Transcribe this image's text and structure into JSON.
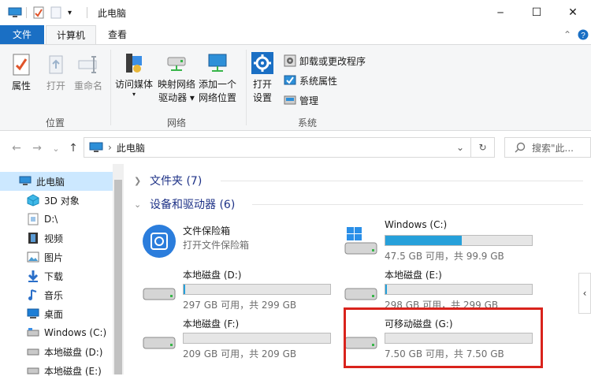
{
  "window": {
    "title": "此电脑",
    "qa_dropdown": "▾",
    "minimize": "─",
    "maximize": "☐",
    "close": "✕"
  },
  "tabs": {
    "file": "文件",
    "computer": "计算机",
    "view": "查看",
    "collapse": "⌃",
    "help": "?"
  },
  "ribbon": {
    "location": {
      "label": "位置",
      "properties": "属性",
      "open": "打开",
      "rename": "重命名"
    },
    "network": {
      "label": "网络",
      "media": "访问媒体",
      "map_drive_1": "映射网络",
      "map_drive_2": "驱动器 ▾",
      "add_location_1": "添加一个",
      "add_location_2": "网络位置"
    },
    "system": {
      "label": "系统",
      "open_settings_1": "打开",
      "open_settings_2": "设置",
      "uninstall": "卸载或更改程序",
      "sys_props": "系统属性",
      "manage": "管理"
    }
  },
  "address": {
    "back": "←",
    "forward": "→",
    "recent": "⌄",
    "up": "↑",
    "path": "此电脑",
    "sep": "›",
    "dropdown": "⌄",
    "refresh": "↻",
    "search_placeholder": "搜索\"此..."
  },
  "sidebar": {
    "items": [
      {
        "label": "此电脑"
      },
      {
        "label": "3D 对象"
      },
      {
        "label": "D:\\"
      },
      {
        "label": "视频"
      },
      {
        "label": "图片"
      },
      {
        "label": "下载"
      },
      {
        "label": "音乐"
      },
      {
        "label": "桌面"
      },
      {
        "label": "Windows (C:)"
      },
      {
        "label": "本地磁盘 (D:)"
      },
      {
        "label": "本地磁盘 (E:)"
      }
    ]
  },
  "content": {
    "folders_section": "文件夹 (7)",
    "devices_section": "设备和驱动器 (6)",
    "vault": {
      "name": "文件保险箱",
      "subtitle": "打开文件保险箱"
    },
    "drives": [
      {
        "name": "Windows (C:)",
        "info": "47.5 GB 可用，共 99.9 GB",
        "used_fraction": 0.52
      },
      {
        "name": "本地磁盘 (D:)",
        "info": "297 GB 可用，共 299 GB",
        "used_fraction": 0.01
      },
      {
        "name": "本地磁盘 (E:)",
        "info": "298 GB 可用，共 299 GB",
        "used_fraction": 0.01
      },
      {
        "name": "本地磁盘 (F:)",
        "info": "209 GB 可用，共 209 GB",
        "used_fraction": 0.0
      },
      {
        "name": "可移动磁盘 (G:)",
        "info": "7.50 GB 可用，共 7.50 GB",
        "used_fraction": 0.0
      }
    ]
  },
  "right_collapse": "‹",
  "colors": {
    "accent": "#1a6fc4",
    "selection": "#cce8ff",
    "bar_fill": "#26a0da",
    "highlight": "#d9231c"
  }
}
